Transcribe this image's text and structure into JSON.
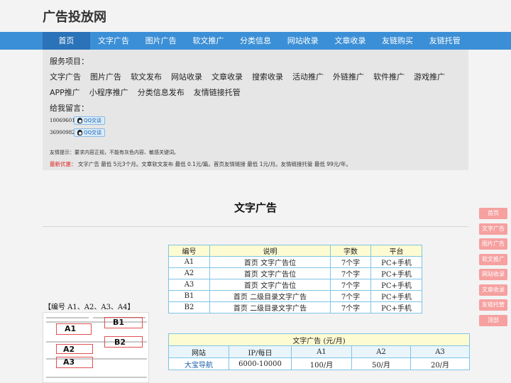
{
  "site": {
    "title": "广告投放网"
  },
  "nav": {
    "items": [
      "首页",
      "文字广告",
      "图片广告",
      "软文推广",
      "分类信息",
      "网站收录",
      "文章收录",
      "友链购买",
      "友链托管"
    ],
    "active_index": 0
  },
  "services": {
    "label": "服务项目：",
    "items": [
      "文字广告",
      "图片广告",
      "软文发布",
      "网站收录",
      "文章收录",
      "搜索收录",
      "活动推广",
      "外链推广",
      "软件推广",
      "游戏推广",
      "APP推广",
      "小程序推广",
      "分类信息发布",
      "友情链接托管"
    ]
  },
  "contact": {
    "label": "给我留言：",
    "qq": [
      {
        "number": "10069601",
        "button": "QQ交谈"
      },
      {
        "number": "369009827",
        "button": "QQ交谈"
      }
    ]
  },
  "tip": "友情提示：要求内容正规，不能有灰色内容、敏感关键词。",
  "offer": {
    "label": "最新优惠：",
    "text": "文字广告 最低 5元3个月。文章软文发布 最低 0.1元/篇。首页友情链接 最低 1元/月。友情链接托管 最低 99元/年。"
  },
  "section": {
    "heading": "文字广告"
  },
  "slot_table": {
    "headers": [
      "编号",
      "说明",
      "字数",
      "平台"
    ],
    "rows": [
      [
        "A1",
        "首页 文字广告位",
        "7个字",
        "PC+手机"
      ],
      [
        "A2",
        "首页 文字广告位",
        "7个字",
        "PC+手机"
      ],
      [
        "A3",
        "首页 文字广告位",
        "7个字",
        "PC+手机"
      ],
      [
        "B1",
        "首页 二级目录文字广告",
        "7个字",
        "PC+手机"
      ],
      [
        "B2",
        "首页 二级目录文字广告",
        "7个字",
        "PC+手机"
      ]
    ]
  },
  "thumbnail": {
    "caption": "【编号 A1、A2、A3、A4】",
    "labels": [
      "A1",
      "B1",
      "A2",
      "B2",
      "A3"
    ]
  },
  "price_table": {
    "caption": "文字广告 (元/月)",
    "headers": [
      "网站",
      "IP/每日",
      "A1",
      "A2",
      "A3"
    ],
    "rows": [
      [
        "大宝导航",
        "6000-10000",
        "100/月",
        "50/月",
        "20/月"
      ]
    ]
  },
  "side_nav": {
    "items": [
      "首页",
      "文字广告",
      "图片广告",
      "软文推广",
      "网站收录",
      "文章收录",
      "友链托管",
      "顶部"
    ]
  },
  "colors": {
    "nav_bg": "#3b8fd6",
    "nav_active": "#2a73b8",
    "side_button": "#f6a0a0",
    "offer_label": "#e02020",
    "table_border": "#7fc4e6",
    "table_header": "#fdfbd2"
  }
}
